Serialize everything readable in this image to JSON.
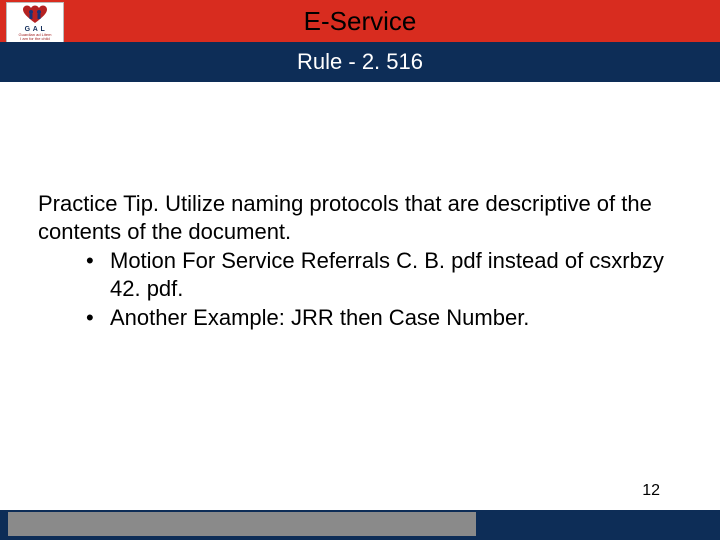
{
  "logo": {
    "text": "G A L",
    "sub1": "Guardian ad Litem",
    "sub2": "I am for the child"
  },
  "title": "E-Service",
  "subtitle": "Rule - 2. 516",
  "body": {
    "intro": "Practice Tip.  Utilize naming protocols that are descriptive of the contents of the document.",
    "bullets": [
      "Motion For Service Referrals C. B. pdf instead of csxrbzy 42. pdf.",
      "Another Example:  JRR then Case Number."
    ]
  },
  "page_number": "12"
}
